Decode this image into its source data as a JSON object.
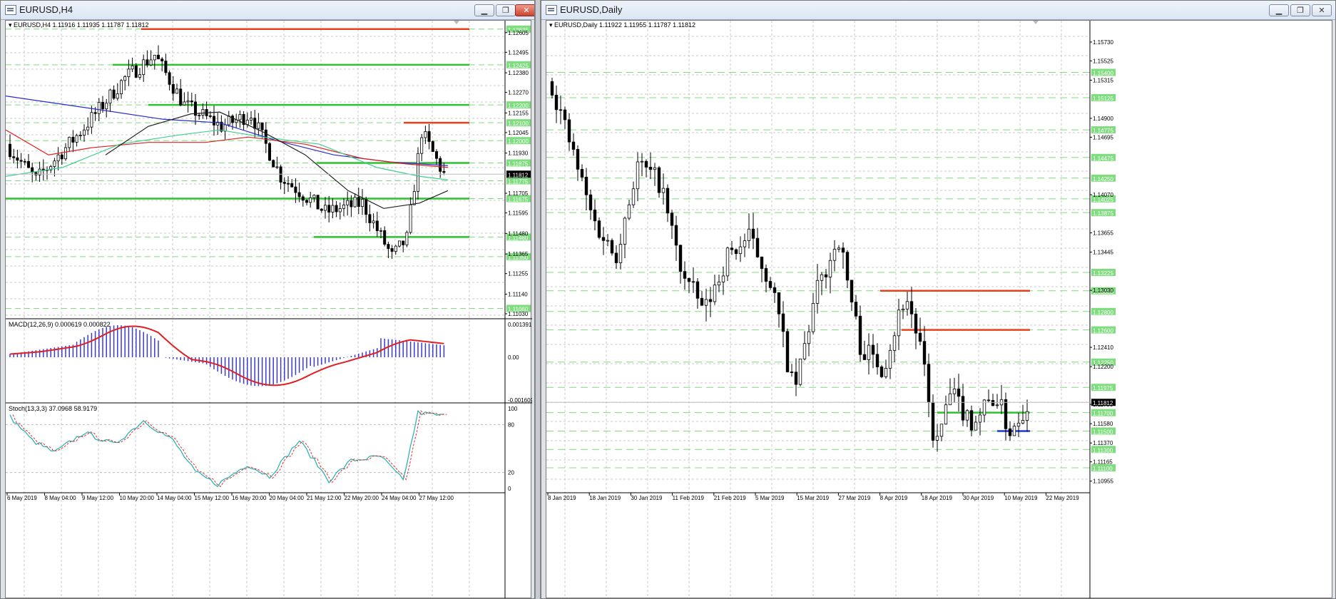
{
  "windows": {
    "left": {
      "title": "EURUSD,H4",
      "controls": [
        "minimize",
        "restore",
        "close"
      ]
    },
    "right": {
      "title": "EURUSD,Daily",
      "controls": [
        "minimize",
        "restore",
        "close"
      ]
    }
  },
  "h4": {
    "header": "EURUSD,H4  1.11916 1.11935 1.11787 1.11812",
    "price_ticks": [
      "1.12605",
      "1.12495",
      "1.12380",
      "1.12270",
      "1.12155",
      "1.12045",
      "1.11930",
      "1.11705",
      "1.11595",
      "1.11480",
      "1.11365",
      "1.11255",
      "1.11140",
      "1.11030"
    ],
    "level_labels": [
      "1.12625",
      "1.12425",
      "1.12200",
      "1.12100",
      "1.12000",
      "1.11875",
      "1.11775",
      "1.11675",
      "1.11460",
      "1.11350",
      "1.11060"
    ],
    "current_price": "1.11812",
    "time_labels": [
      "6 May 2019",
      "8 May 04:00",
      "9 May 12:00",
      "10 May 20:00",
      "14 May 04:00",
      "15 May 12:00",
      "16 May 20:00",
      "20 May 04:00",
      "21 May 12:00",
      "22 May 20:00",
      "24 May 04:00",
      "27 May 12:00"
    ],
    "macd": {
      "header": "MACD(12,26,9) 0.000619 0.000822",
      "ticks": [
        "0.001391",
        "0.00",
        "-0.001609"
      ]
    },
    "stoch": {
      "header": "Stoch(13,3,3) 37.0968 58.9179",
      "ticks": [
        "100",
        "80",
        "20",
        "0"
      ]
    }
  },
  "daily": {
    "header": "EURUSD,Daily  1.11922 1.11955 1.11787 1.11812",
    "price_ticks": [
      "1.15730",
      "1.15525",
      "1.15315",
      "1.14900",
      "1.14695",
      "1.14070",
      "1.13655",
      "1.13445",
      "1.13030",
      "1.12410",
      "1.12200",
      "1.11790",
      "1.11580",
      "1.11370",
      "1.11165",
      "1.10955"
    ],
    "level_labels": [
      "1.15400",
      "1.15125",
      "1.14775",
      "1.14475",
      "1.14250",
      "1.14025",
      "1.13875",
      "1.13225",
      "1.13025",
      "1.12800",
      "1.12600",
      "1.12250",
      "1.11975",
      "1.11700",
      "1.11500",
      "1.11300",
      "1.11100"
    ],
    "current_price": "1.11812",
    "time_labels": [
      "8 Jan 2019",
      "18 Jan 2019",
      "30 Jan 2019",
      "11 Feb 2019",
      "21 Feb 2019",
      "5 Mar 2019",
      "15 Mar 2019",
      "27 Mar 2019",
      "8 Apr 2019",
      "18 Apr 2019",
      "30 Apr 2019",
      "10 May 2019",
      "22 May 2019"
    ]
  },
  "colors": {
    "support": "#2ec22e",
    "resistance": "#e8401c",
    "level_dash": "#7fdc7f",
    "level_label_bg": "#7fdc7f",
    "price_label_bg": "#000000",
    "ma_blue": "#2a2ad0",
    "ma_red": "#e02020",
    "ma_green": "#3fcf8f",
    "ma_black": "#222222",
    "macd_bar": "#3a3ad8",
    "stoch_main": "#20b0b0",
    "stoch_signal": "#e03030",
    "pivot_blue": "#1a3ad8"
  }
}
